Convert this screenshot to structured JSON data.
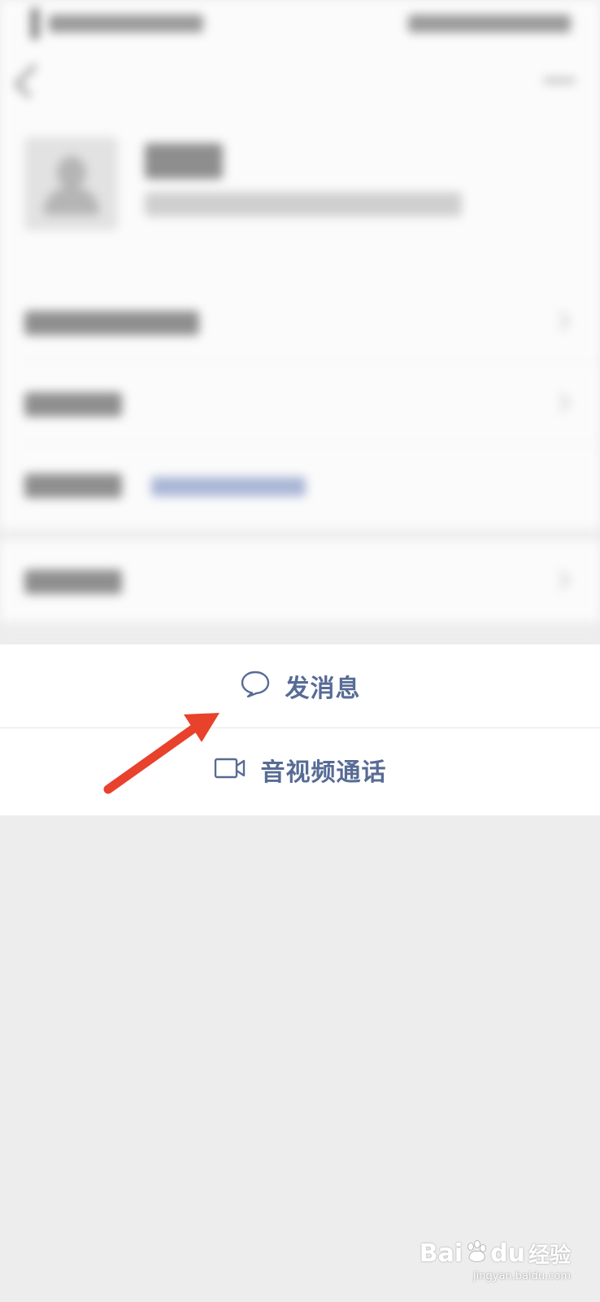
{
  "actions": {
    "send_message": {
      "label": "发消息",
      "icon": "chat-bubble-icon"
    },
    "av_call": {
      "label": "音视频通话",
      "icon": "video-camera-icon"
    }
  },
  "watermark": {
    "brand": "Bai",
    "brand_tail": "du",
    "product": "经验",
    "url": "jingyan.baidu.com"
  },
  "colors": {
    "action_text": "#576b95",
    "annotation_arrow": "#e8412c",
    "page_background": "#ededed",
    "sheet_background": "#ffffff"
  }
}
